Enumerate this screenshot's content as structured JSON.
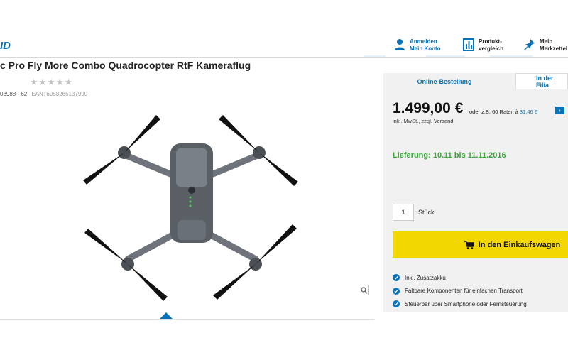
{
  "header": {
    "logo": "ID",
    "account": {
      "line1": "Anmelden",
      "line2": "Mein Konto",
      "icon": "user-icon"
    },
    "compare": {
      "line1": "Produkt-",
      "line2": "vergleich",
      "icon": "compare-icon"
    },
    "wishlist": {
      "line1": "Mein",
      "line2": "Merkzettel",
      "icon": "pin-icon"
    }
  },
  "product": {
    "title": "c Pro Fly More Combo Quadrocopter RtF Kameraflug",
    "stars": "★★★★★",
    "article_no": "08988 - 62",
    "ean": "EAN: 6958265137990",
    "image_icon": "drone-image",
    "zoom_icon": "magnifier-icon"
  },
  "buy_box": {
    "tabs": [
      "Online-Bestellung",
      "In der Filia"
    ],
    "price": "1.499,00 €",
    "raten_text": "oder z.B. 60 Raten à",
    "raten_amount": "31,46 €",
    "mwst_text": "inkl. MwSt., zzgl.",
    "versand_link": "Versand",
    "delivery": "Lieferung: 10.11 bis 11.11.2016",
    "quantity": "1",
    "quantity_unit": "Stück",
    "cart_label": "In den Einkaufswagen",
    "features": [
      "Inkl. Zusatzakku",
      "Faltbare Komponenten für einfachen Transport",
      "Steuerbar über Smartphone oder Fernsteuerung"
    ]
  },
  "colors": {
    "brand_blue": "#0a73b7",
    "cart_yellow": "#f2d700",
    "delivery_green": "#3aa53a"
  }
}
